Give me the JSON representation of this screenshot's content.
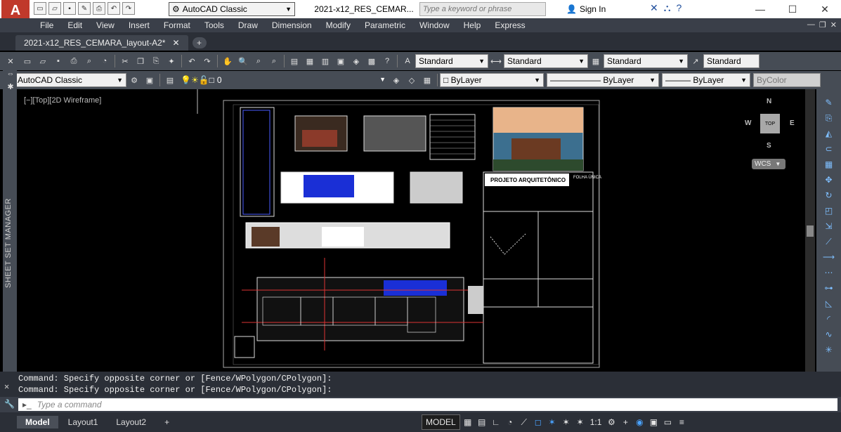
{
  "titlebar": {
    "workspace": "AutoCAD Classic",
    "window_title": "2021-x12_RES_CEMAR...",
    "search_placeholder": "Type a keyword or phrase",
    "signin_label": "Sign In"
  },
  "menu": [
    "File",
    "Edit",
    "View",
    "Insert",
    "Format",
    "Tools",
    "Draw",
    "Dimension",
    "Modify",
    "Parametric",
    "Window",
    "Help",
    "Express"
  ],
  "file_tab": {
    "label": "2021-x12_RES_CEMARA_layout-A2*"
  },
  "toolbar1": {
    "text_style": "Standard",
    "dim_style": "Standard",
    "table_style": "Standard",
    "mleader_style": "Standard"
  },
  "toolbar2": {
    "workspace": "AutoCAD Classic",
    "layer": "0",
    "color": "ByLayer",
    "linetype": "ByLayer",
    "lineweight": "ByLayer",
    "plotstyle": "ByColor"
  },
  "palette_label": "SHEET SET MANAGER",
  "viewport": {
    "label": "[−][Top][2D Wireframe]",
    "compass": {
      "n": "N",
      "s": "S",
      "e": "E",
      "w": "W"
    },
    "cube_face": "TOP",
    "wcs": "WCS",
    "drawing": {
      "title_block_heading": "PROJETO ARQUITETÔNICO",
      "sheet_label": "FOLHA ÚNICA"
    }
  },
  "command": {
    "history": [
      "Command: Specify opposite corner or [Fence/WPolygon/CPolygon]:",
      "Command: Specify opposite corner or [Fence/WPolygon/CPolygon]:"
    ],
    "placeholder": "Type a command"
  },
  "layout_tabs": [
    "Model",
    "Layout1",
    "Layout2"
  ],
  "status": {
    "model": "MODEL",
    "scale": "1:1"
  },
  "colors": {
    "accent_blue": "#1f4e9c",
    "toolbar_bg": "#464c55",
    "menu_bg": "#3a3f49"
  }
}
